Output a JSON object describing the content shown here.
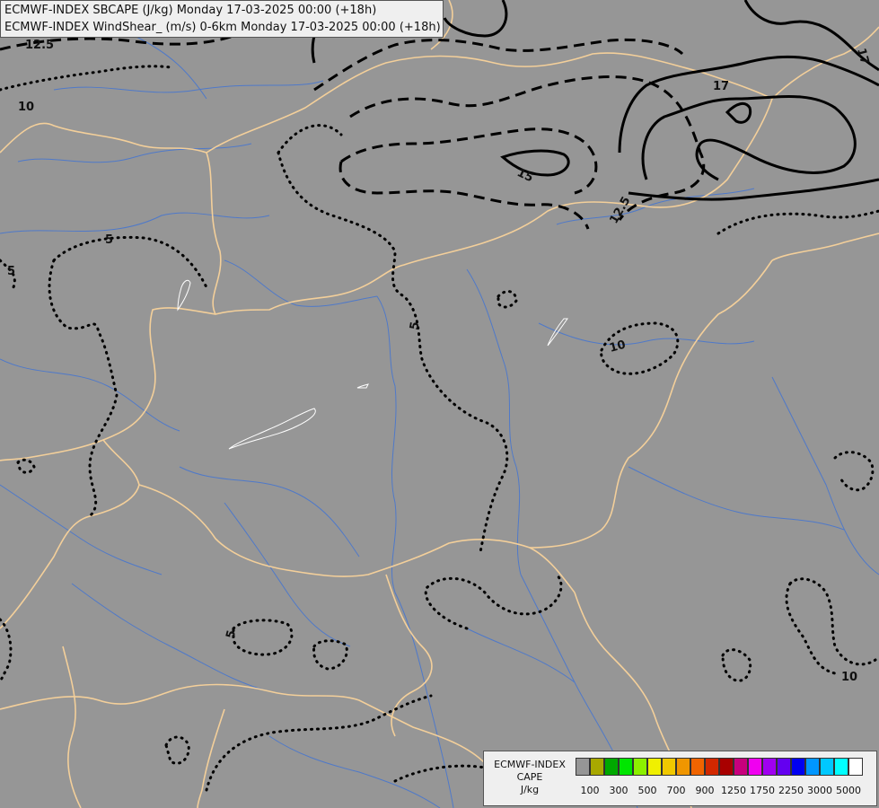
{
  "header": {
    "line1": "ECMWF-INDEX SBCAPE (J/kg) Monday 17-03-2025 00:00 (+18h)",
    "line2": "ECMWF-INDEX WindShear_ (m/s) 0-6km Monday 17-03-2025 00:00 (+18h)"
  },
  "map": {
    "background_color": "#969696",
    "border_color": "#f3cf9a",
    "river_color": "#4f79c9",
    "lake_color": "#ffffff",
    "contour_color": "#000000",
    "contour_labels": [
      {
        "text": "12.5"
      },
      {
        "text": "10"
      },
      {
        "text": "5"
      },
      {
        "text": "5"
      },
      {
        "text": "15"
      },
      {
        "text": "12.5"
      },
      {
        "text": "17"
      },
      {
        "text": "17"
      },
      {
        "text": "5"
      },
      {
        "text": "10"
      },
      {
        "text": "5"
      },
      {
        "text": "10"
      }
    ]
  },
  "legend": {
    "title_line1": "ECMWF-INDEX",
    "title_line2": "CAPE",
    "title_line3": "J/kg",
    "colors": [
      "#969696",
      "#a8a800",
      "#00a800",
      "#00e600",
      "#8cf000",
      "#f0f000",
      "#f0c800",
      "#f09600",
      "#f06400",
      "#d22800",
      "#a80000",
      "#c8007d",
      "#f000f0",
      "#a000f0",
      "#6400f0",
      "#0000f0",
      "#0096ff",
      "#00c8ff",
      "#00ffff",
      "#ffffff"
    ],
    "ticks": [
      "100",
      "300",
      "500",
      "700",
      "900",
      "1250",
      "1750",
      "2250",
      "3000",
      "5000"
    ]
  }
}
